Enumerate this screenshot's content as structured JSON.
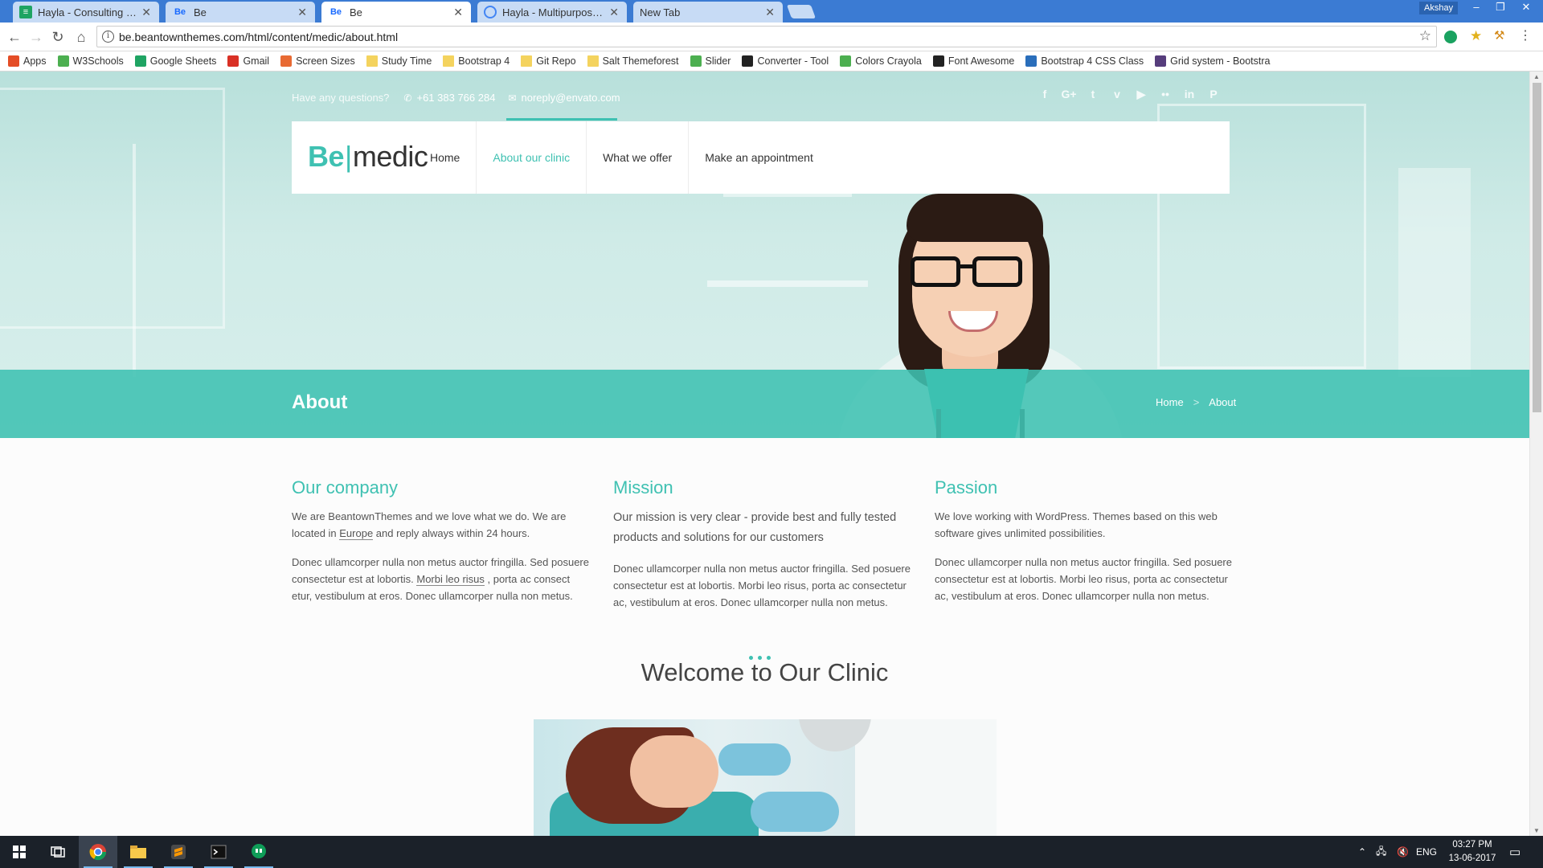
{
  "browser": {
    "tabs": [
      {
        "title": "Hayla - Consulting HTML",
        "icon": "sheets-icon",
        "color": "#1fa463",
        "active": false
      },
      {
        "title": "Be",
        "icon": "be-icon",
        "color": "#1769ff",
        "active": false
      },
      {
        "title": "Be",
        "icon": "be-icon",
        "color": "#1769ff",
        "active": true
      },
      {
        "title": "Hayla - Multipurpose Bu",
        "icon": "chrome-icon",
        "color": "#4285f4",
        "active": false
      },
      {
        "title": "New Tab",
        "icon": "",
        "color": "",
        "active": false
      }
    ],
    "profile": "Akshay",
    "url": "be.beantownthemes.com/html/content/medic/about.html",
    "bookmarks": [
      {
        "label": "Apps",
        "icon": "apps-grid-icon",
        "color": "#e44d26"
      },
      {
        "label": "W3Schools",
        "icon": "w3schools-icon",
        "color": "#4caf50"
      },
      {
        "label": "Google Sheets",
        "icon": "sheets-icon",
        "color": "#1fa463"
      },
      {
        "label": "Gmail",
        "icon": "gmail-icon",
        "color": "#d93025"
      },
      {
        "label": "Screen Sizes",
        "icon": "screen-sizes-icon",
        "color": "#e86a33"
      },
      {
        "label": "Study Time",
        "icon": "folder-icon",
        "color": "#f4d35e"
      },
      {
        "label": "Bootstrap 4",
        "icon": "folder-icon",
        "color": "#f4d35e"
      },
      {
        "label": "Git Repo",
        "icon": "folder-icon",
        "color": "#f4d35e"
      },
      {
        "label": "Salt Themeforest",
        "icon": "folder-icon",
        "color": "#f4d35e"
      },
      {
        "label": "Slider",
        "icon": "w3schools-icon",
        "color": "#4caf50"
      },
      {
        "label": "Converter - Tool",
        "icon": "bt-icon",
        "color": "#222222"
      },
      {
        "label": "Colors Crayola",
        "icon": "w3schools-icon",
        "color": "#4caf50"
      },
      {
        "label": "Font Awesome",
        "icon": "font-awesome-icon",
        "color": "#222222"
      },
      {
        "label": "Bootstrap 4 CSS Class",
        "icon": "pen-icon",
        "color": "#2a6ebb"
      },
      {
        "label": "Grid system - Bootstra",
        "icon": "bootstrap-icon",
        "color": "#563d7c"
      }
    ]
  },
  "site": {
    "contact": {
      "question": "Have any questions?",
      "phone": "+61 383 766 284",
      "email": "noreply@envato.com"
    },
    "socials": [
      "facebook-icon",
      "google-plus-icon",
      "twitter-icon",
      "vimeo-icon",
      "youtube-icon",
      "flickr-icon",
      "linkedin-icon",
      "pinterest-icon"
    ],
    "logo": {
      "be": "Be",
      "sep": "|",
      "medic": "medic"
    },
    "menu": [
      {
        "label": "Home",
        "active": false
      },
      {
        "label": "About our clinic",
        "active": true
      },
      {
        "label": "What we offer",
        "active": false
      },
      {
        "label": "Make an appointment",
        "active": false
      }
    ],
    "page_title": "About",
    "breadcrumb": {
      "home": "Home",
      "sep": ">",
      "current": "About"
    },
    "columns": [
      {
        "heading": "Our company",
        "p1_before": "We are BeantownThemes and we love what we do. We are located in ",
        "p1_link": "Europe",
        "p1_after": " and reply always within 24 hours.",
        "p2_before": "Donec ullamcorper nulla non metus auctor fringilla. Sed posuere consectetur est at lobortis. ",
        "p2_link": "Morbi leo risus",
        "p2_after": " , porta ac consect etur, vestibulum at eros. Donec ullamcorper nulla non metus."
      },
      {
        "heading": "Mission",
        "p1": "Our mission is very clear - provide best and fully tested products and solutions for our customers",
        "p2": "Donec ullamcorper nulla non metus auctor fringilla. Sed posuere consectetur est at lobortis. Morbi leo risus, porta ac consectetur ac, vestibulum at eros. Donec ullamcorper nulla non metus."
      },
      {
        "heading": "Passion",
        "p1": "We love working with WordPress. Themes based on this web software gives unlimited possibilities.",
        "p2": "Donec ullamcorper nulla non metus auctor fringilla. Sed posuere consectetur est at lobortis. Morbi leo risus, porta ac consectetur ac, vestibulum at eros. Donec ullamcorper nulla non metus."
      }
    ],
    "welcome": "Welcome to Our Clinic",
    "accent": "#3fc1b2"
  },
  "taskbar": {
    "apps": [
      "windows-start-icon",
      "task-view-icon",
      "chrome-icon",
      "file-explorer-icon",
      "sublime-icon",
      "terminal-icon",
      "hangouts-icon"
    ],
    "lang": "ENG",
    "time": "03:27 PM",
    "date": "13-06-2017"
  }
}
